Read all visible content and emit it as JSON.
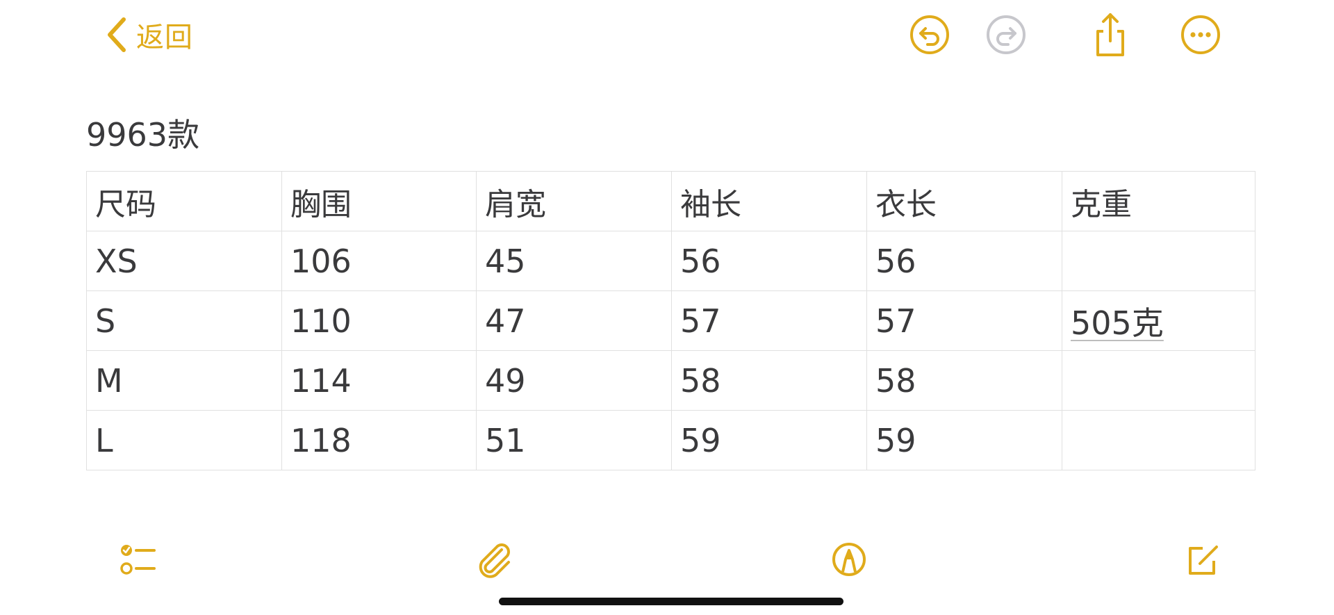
{
  "colors": {
    "accent": "#E0AB1B",
    "disabled": "#C7C7CC",
    "text": "#3A3A3C",
    "grid": "#E0E0E0"
  },
  "nav": {
    "back_label": "返回",
    "icons": {
      "back": "chevron-left-icon",
      "undo": "undo-icon",
      "redo": "redo-icon",
      "share": "share-icon",
      "more": "ellipsis-circle-icon"
    }
  },
  "note": {
    "title": "9963款",
    "table": {
      "headers": [
        "尺码",
        "胸围",
        "肩宽",
        "袖长",
        "衣长",
        "克重"
      ],
      "rows": [
        [
          "XS",
          "106",
          "45",
          "56",
          "56",
          ""
        ],
        [
          "S",
          "110",
          "47",
          "57",
          "57",
          "505克"
        ],
        [
          "M",
          "114",
          "49",
          "58",
          "58",
          ""
        ],
        [
          "L",
          "118",
          "51",
          "59",
          "59",
          ""
        ]
      ]
    }
  },
  "toolbar": {
    "icons": {
      "checklist": "checklist-icon",
      "attachment": "paperclip-icon",
      "markup": "pen-tip-circle-icon",
      "compose": "compose-icon"
    }
  }
}
